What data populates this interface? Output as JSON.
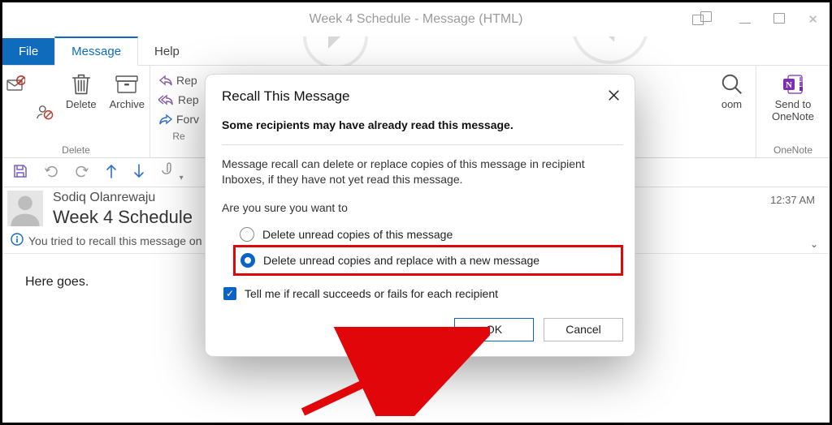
{
  "titlebar": {
    "title": "Week 4 Schedule  -  Message (HTML)"
  },
  "tabs": {
    "file": "File",
    "message": "Message",
    "help": "Help"
  },
  "ribbon": {
    "delete": "Delete",
    "archive": "Archive",
    "group_delete": "Delete",
    "reply": "Rep",
    "reply_all": "Rep",
    "forward": "Forv",
    "re_label": "Re",
    "zoom": "oom",
    "send_onenote_1": "Send to",
    "send_onenote_2": "OneNote",
    "group_onenote": "OneNote"
  },
  "message": {
    "sender": "Sodiq Olanrewaju",
    "subject": "Week 4 Schedule",
    "time": "12:37 AM",
    "recall_notice": "You tried to recall this message on",
    "body": "Here goes."
  },
  "dialog": {
    "title": "Recall This Message",
    "warning": "Some recipients may have already read this message.",
    "explanation": "Message recall can delete or replace copies of this message in recipient Inboxes, if they have not yet read this message.",
    "prompt": "Are you sure you want to",
    "opt_delete": "Delete unread copies of this message",
    "opt_replace": "Delete unread copies and replace with a new message",
    "checkbox": "Tell me if recall succeeds or fails for each recipient",
    "ok": "OK",
    "cancel": "Cancel"
  }
}
